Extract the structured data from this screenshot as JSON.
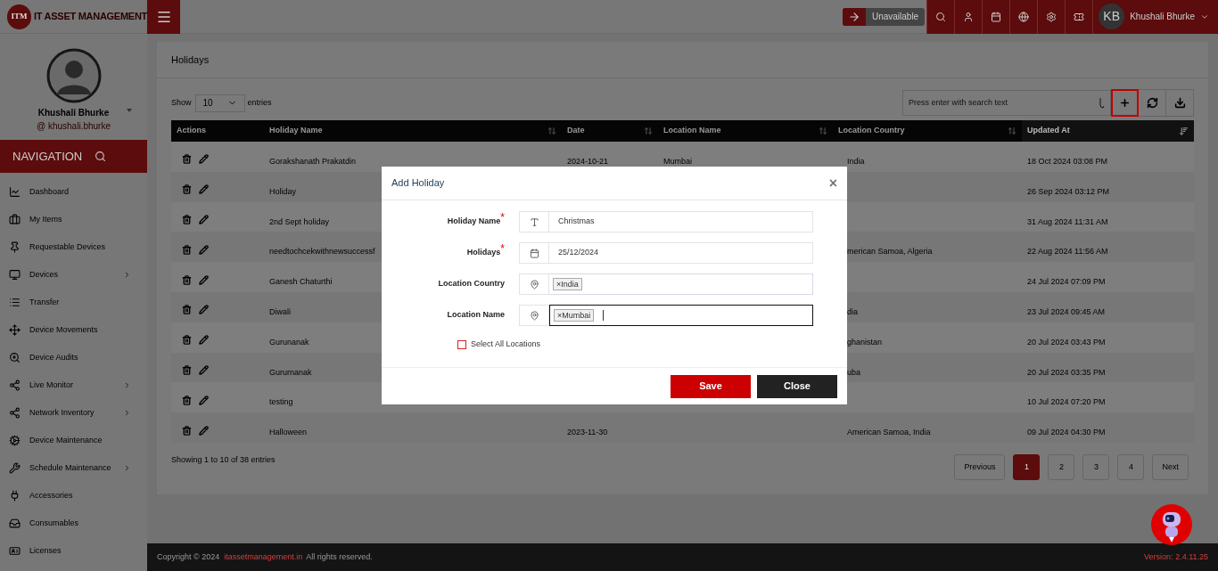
{
  "header": {
    "logo_mark": "ITM",
    "logo_text": "IT ASSET MANAGEMENT",
    "status": "Unavailable",
    "user_initials": "KB",
    "user_name": "Khushali Bhurke"
  },
  "profile": {
    "name": "Khushali Bhurke",
    "handle": "@ khushali.bhurke"
  },
  "navigation": {
    "title": "NAVIGATION",
    "items": [
      {
        "label": "Dashboard",
        "has_submenu": false
      },
      {
        "label": "My Items",
        "has_submenu": false
      },
      {
        "label": "Requestable Devices",
        "has_submenu": false
      },
      {
        "label": "Devices",
        "has_submenu": true
      },
      {
        "label": "Transfer",
        "has_submenu": false
      },
      {
        "label": "Device Movements",
        "has_submenu": false
      },
      {
        "label": "Device Audits",
        "has_submenu": false
      },
      {
        "label": "Live Monitor",
        "has_submenu": true
      },
      {
        "label": "Network Inventory",
        "has_submenu": true
      },
      {
        "label": "Device Maintenance",
        "has_submenu": false
      },
      {
        "label": "Schedule Maintenance",
        "has_submenu": true
      },
      {
        "label": "Accessories",
        "has_submenu": false
      },
      {
        "label": "Consumables",
        "has_submenu": false
      },
      {
        "label": "Licenses",
        "has_submenu": false
      }
    ]
  },
  "page": {
    "title": "Holidays",
    "show_label": "Show",
    "page_size": "10",
    "entries_label": "entries",
    "search": {
      "placeholder": "Press enter with search text"
    },
    "toolbar": [
      {
        "kind": "add",
        "focused": true
      },
      {
        "kind": "refresh",
        "focused": false
      },
      {
        "kind": "download",
        "focused": false
      }
    ],
    "table": {
      "columns": [
        {
          "label": "Actions"
        },
        {
          "label": "Holiday Name",
          "sortable": true,
          "sorted": false
        },
        {
          "label": "Date",
          "sortable": true,
          "sorted": false
        },
        {
          "label": "Location Name",
          "sortable": true,
          "sorted": false
        },
        {
          "label": "Location Country",
          "sortable": true,
          "sorted": false
        },
        {
          "label": "Updated At",
          "sortable": true,
          "sorted": true
        }
      ],
      "rows": [
        {
          "holiday_name": "Gorakshanath Prakatdin",
          "date": "2024-10-21",
          "location_name": "Mumbai",
          "location_country": "India",
          "updated_at": "18 Oct 2024 03:08 PM"
        },
        {
          "holiday_name": "Holiday",
          "updated_at": "26 Sep 2024 03:12 PM"
        },
        {
          "holiday_name": "2nd Sept holiday",
          "updated_at": "31 Aug 2024 11:31 AM"
        },
        {
          "holiday_name": "needtochcekwithnewsuccessf",
          "location_country": "merican Samoa, Algeria",
          "updated_at": "22 Aug 2024 11:56 AM"
        },
        {
          "holiday_name": "Ganesh Chaturthi",
          "updated_at": "24 Jul 2024 07:09 PM"
        },
        {
          "holiday_name": "Diwali",
          "location_country": "dia",
          "updated_at": "23 Jul 2024 09:45 AM"
        },
        {
          "holiday_name": "Gurunanak",
          "location_country": "ghanistan",
          "updated_at": "20 Jul 2024 03:43 PM"
        },
        {
          "holiday_name": "Gururnanak",
          "location_country": "uba",
          "updated_at": "20 Jul 2024 03:35 PM"
        },
        {
          "holiday_name": "testing",
          "updated_at": "10 Jul 2024 07:20 PM"
        },
        {
          "holiday_name": "Halloween",
          "date": "2023-11-30",
          "location_country": "American Samoa, India",
          "updated_at": "09 Jul 2024 04:30 PM"
        }
      ]
    },
    "summary": "Showing 1 to 10 of 38 entries",
    "pagination": [
      {
        "label": "Previous",
        "selected": false
      },
      {
        "label": "1",
        "selected": true
      },
      {
        "label": "2",
        "selected": false
      },
      {
        "label": "3",
        "selected": false
      },
      {
        "label": "4",
        "selected": false
      },
      {
        "label": "Next",
        "selected": false
      }
    ]
  },
  "dialog": {
    "title": "Add Holiday",
    "close": "×",
    "fields": [
      {
        "label": "Holiday Name",
        "required_mark": "*",
        "kind": "text",
        "value": "Christmas"
      },
      {
        "label": "Holidays",
        "required_mark": "*",
        "kind": "date",
        "value": "25/12/2024"
      },
      {
        "label": "Location Country",
        "kind": "tags",
        "tags": [
          {
            "remove": "×",
            "label": "India"
          }
        ],
        "focused": false
      },
      {
        "label": "Location Name",
        "kind": "tags",
        "tags": [
          {
            "remove": "×",
            "label": "Mumbai"
          }
        ],
        "focused": true
      }
    ],
    "select_all": {
      "label": "Select All Locations",
      "checked": false
    },
    "buttons": [
      {
        "label": "Save",
        "kind": "primary"
      },
      {
        "label": "Close",
        "kind": "secondary"
      }
    ]
  },
  "footer": {
    "copyright": "Copyright © 2024",
    "link": "itassetmanagement.in",
    "rights": "All rights reserved.",
    "version": "Version: 2.4.11.25"
  }
}
